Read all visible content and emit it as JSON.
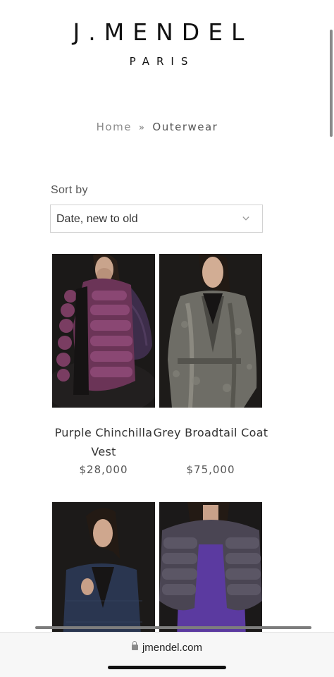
{
  "header": {
    "brand": "J.MENDEL",
    "brand_sub": "PARIS"
  },
  "breadcrumb": {
    "home": "Home",
    "separator": "»",
    "current": "Outerwear"
  },
  "sort": {
    "label": "Sort by",
    "selected": "Date, new to old"
  },
  "products": [
    {
      "title": "Purple Chinchilla Vest",
      "price": "$28,000",
      "image": "model-purple-fur-vest"
    },
    {
      "title": "Grey Broadtail Coat",
      "price": "$75,000",
      "image": "model-grey-broadtail-coat"
    },
    {
      "title": "",
      "price": "",
      "image": "model-navy-jacket"
    },
    {
      "title": "",
      "price": "",
      "image": "model-grey-fur-bolero"
    }
  ],
  "browser": {
    "url": "jmendel.com"
  },
  "colors": {
    "image_bg": "#1b1918",
    "purple_fur": "#7a3d62",
    "grey_coat": "#7c7a72",
    "navy_jacket": "#2a3650",
    "grey_fur": "#4a4553"
  }
}
